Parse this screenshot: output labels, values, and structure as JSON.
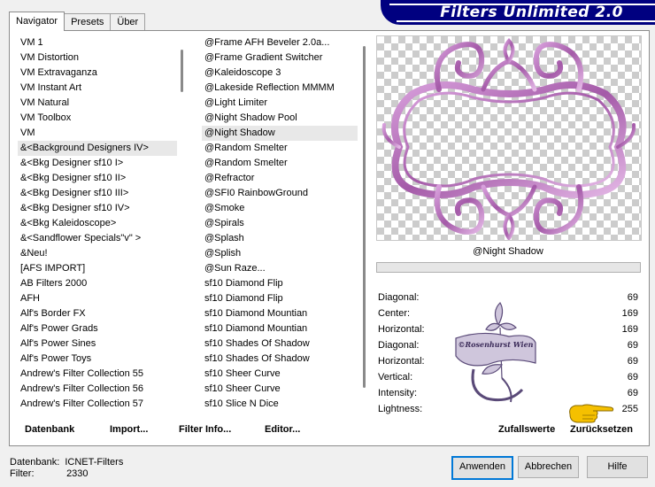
{
  "app": {
    "title": "Filters Unlimited 2.0"
  },
  "tabs": [
    {
      "label": "Navigator",
      "active": true
    },
    {
      "label": "Presets",
      "active": false
    },
    {
      "label": "Über",
      "active": false
    }
  ],
  "categories": [
    "VM 1",
    "VM Distortion",
    "VM Extravaganza",
    "VM Instant Art",
    "VM Natural",
    "VM Toolbox",
    "VM",
    "&<Background Designers IV>",
    "&<Bkg Designer sf10 I>",
    "&<Bkg Designer sf10 II>",
    "&<Bkg Designer sf10 III>",
    "&<Bkg Designer sf10 IV>",
    "&<Bkg Kaleidoscope>",
    "&<Sandflower Specials\"v\" >",
    "&Neu!",
    "[AFS IMPORT]",
    "AB Filters 2000",
    "AFH",
    "Alf's Border FX",
    "Alf's Power Grads",
    "Alf's Power Sines",
    "Alf's Power Toys",
    "Andrew's Filter Collection 55",
    "Andrew's Filter Collection 56",
    "Andrew's Filter Collection 57"
  ],
  "filters": [
    "@Frame AFH Beveler 2.0a...",
    "@Frame Gradient Switcher",
    "@Kaleidoscope 3",
    "@Lakeside Reflection MMMM",
    "@Light Limiter",
    "@Night Shadow Pool",
    "@Night Shadow",
    "@Random Smelter",
    "@Random Smelter",
    "@Refractor",
    "@SFI0 RainbowGround",
    "@Smoke",
    "@Spirals",
    "@Splash",
    "@Splish",
    "@Sun Raze...",
    "sf10 Diamond Flip",
    "sf10 Diamond Flip",
    "sf10 Diamond Mountian",
    "sf10 Diamond Mountian",
    "sf10 Shades Of Shadow",
    "sf10 Shades Of Shadow",
    "sf10 Sheer Curve",
    "sf10 Sheer Curve",
    "sf10 Slice N Dice"
  ],
  "selected_filter": "@Night Shadow",
  "params": [
    {
      "label": "Diagonal:",
      "value": "69"
    },
    {
      "label": "Center:",
      "value": "169"
    },
    {
      "label": "Horizontal:",
      "value": "169"
    },
    {
      "label": "Diagonal:",
      "value": "69"
    },
    {
      "label": "Horizontal:",
      "value": "69"
    },
    {
      "label": "Vertical:",
      "value": "69"
    },
    {
      "label": "Intensity:",
      "value": "69"
    },
    {
      "label": "Lightness:",
      "value": "255"
    }
  ],
  "buttons": {
    "datenbank": "Datenbank",
    "import": "Import...",
    "filter_info": "Filter Info...",
    "editor": "Editor...",
    "zufallswerte": "Zufallswerte",
    "zuruecksetzen": "Zurücksetzen",
    "anwenden": "Anwenden",
    "abbrechen": "Abbrechen",
    "hilfe": "Hilfe"
  },
  "watermark": {
    "text": "©Rosenhurst Wien"
  },
  "status": {
    "datenbank_label": "Datenbank:",
    "datenbank_value": "ICNET-Filters",
    "filter_label": "Filter:",
    "filter_value": "2330"
  },
  "colors": {
    "banner": "#000080",
    "frame": "#b070b8",
    "accent": "#0078d7"
  }
}
